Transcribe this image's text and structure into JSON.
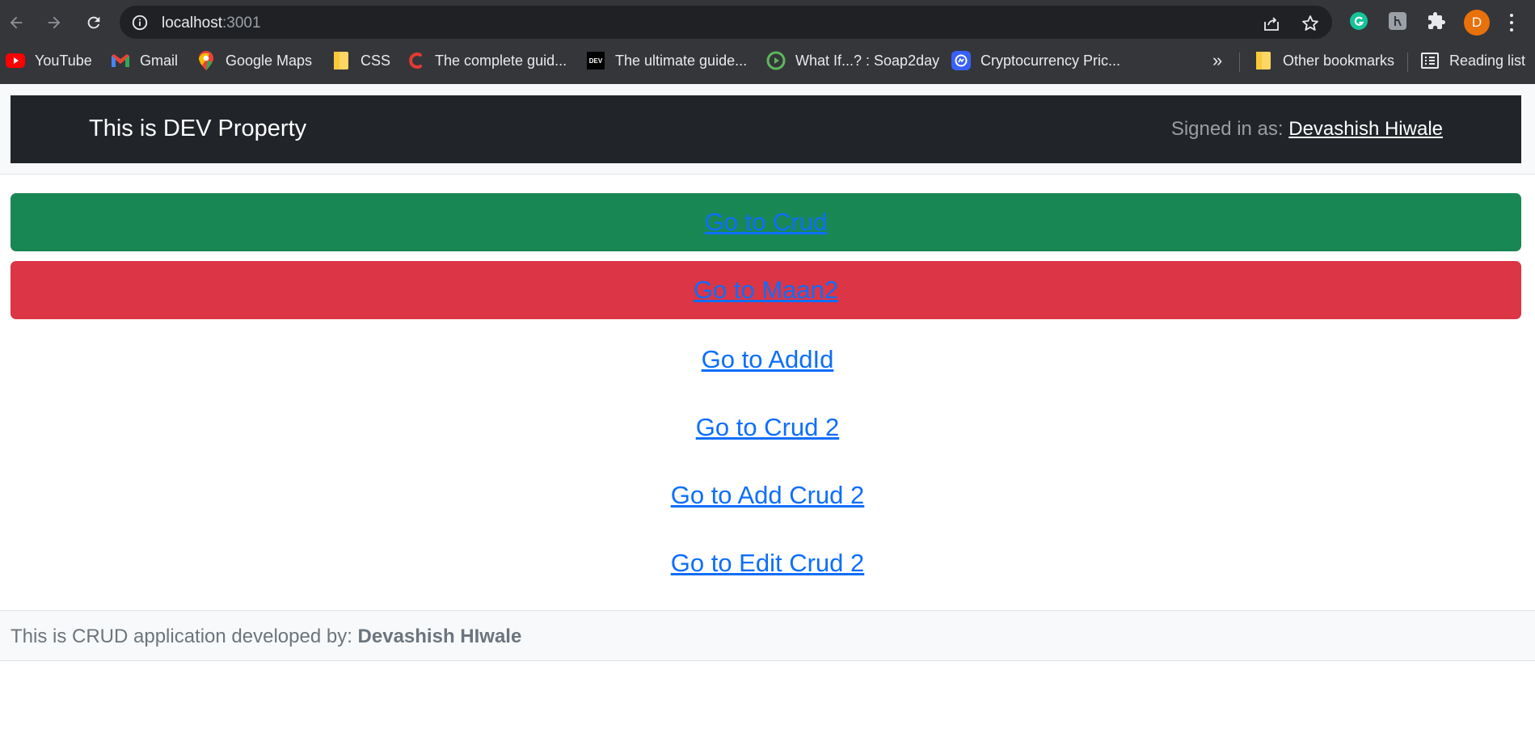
{
  "browser": {
    "url_host": "localhost",
    "url_port": ":3001",
    "profile_initial": "D",
    "bookmarks": [
      {
        "label": "YouTube",
        "icon": "youtube-icon"
      },
      {
        "label": "Gmail",
        "icon": "gmail-icon"
      },
      {
        "label": "Google Maps",
        "icon": "maps-icon"
      },
      {
        "label": "CSS",
        "icon": "folder-icon"
      },
      {
        "label": "The complete guid...",
        "icon": "c-logo-icon"
      },
      {
        "label": "The ultimate guide...",
        "icon": "dev-icon"
      },
      {
        "label": "What If...? : Soap2day",
        "icon": "play-icon"
      },
      {
        "label": "Cryptocurrency Pric...",
        "icon": "coinmarketcap-icon"
      }
    ],
    "overflow_label": "»",
    "other_bookmarks": "Other bookmarks",
    "reading_list": "Reading list",
    "dev_badge": "DEV"
  },
  "navbar": {
    "brand": "This is DEV Property",
    "signed_in_prefix": "Signed in as:",
    "user_name": "Devashish Hiwale"
  },
  "links": {
    "crud": "Go to Crud",
    "maan2": "Go to Maan2",
    "addid": "Go to AddId",
    "crud2": "Go to Crud 2",
    "add_crud2": "Go to Add Crud 2",
    "edit_crud2": "Go to Edit Crud 2"
  },
  "footer": {
    "prefix": "This is CRUD application developed by:",
    "author": "Devashish HIwale"
  },
  "colors": {
    "chrome_bg": "#35363a",
    "navbar_bg": "#212529",
    "success": "#198754",
    "danger": "#dc3545",
    "link": "#0d6efd"
  }
}
